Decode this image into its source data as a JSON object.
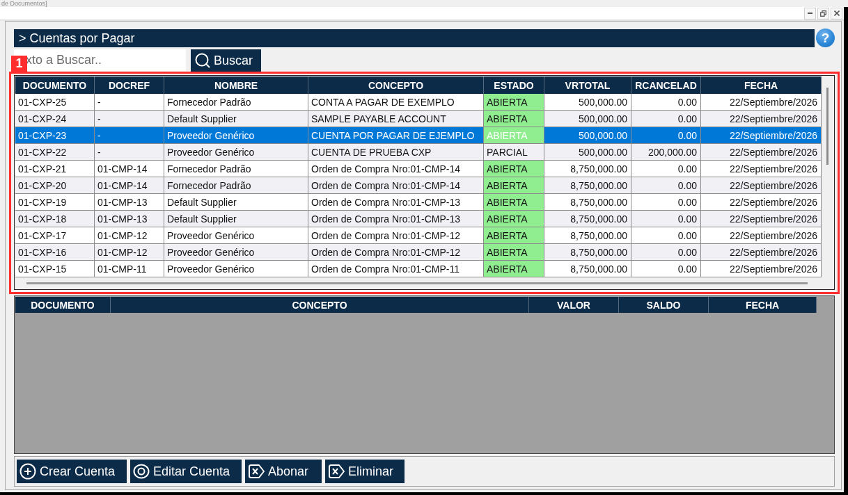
{
  "window": {
    "title": "de Documentos]"
  },
  "section": {
    "title": "> Cuentas por Pagar",
    "help": "?"
  },
  "search": {
    "placeholder": "xto a Buscar..",
    "button": "Buscar"
  },
  "annotation": {
    "label": "1"
  },
  "table": {
    "columns": [
      "DOCUMENTO",
      "DOCREF",
      "NOMBRE",
      "CONCEPTO",
      "ESTADO",
      "VRTOTAL",
      "RCANCELAD",
      "FECHA"
    ],
    "rows": [
      {
        "selected": false,
        "documento": "01-CXP-25",
        "docref": "-",
        "nombre": "Fornecedor Padrão",
        "concepto": "CONTA A PAGAR DE EXEMPLO",
        "estado": {
          "label": "ABIERTA",
          "color": "#90ee90"
        },
        "vrtotal": "500,000.00",
        "column_7": "0.00",
        "fecha": "22/Septiembre/2026"
      },
      {
        "selected": false,
        "documento": "01-CXP-24",
        "docref": "-",
        "nombre": "Default Supplier",
        "concepto": "SAMPLE PAYABLE ACCOUNT",
        "estado": {
          "label": "ABIERTA",
          "color": "#90ee90"
        },
        "vrtotal": "500,000.00",
        "column_7": "0.00",
        "fecha": "22/Septiembre/2026"
      },
      {
        "selected": true,
        "documento": "01-CXP-23",
        "docref": "-",
        "nombre": "Proveedor Genérico",
        "concepto": "CUENTA POR PAGAR DE EJEMPLO",
        "estado": {
          "label": "ABIERTA",
          "color": "#90ee90"
        },
        "vrtotal": "500,000.00",
        "column_7": "0.00",
        "fecha": "22/Septiembre/2026"
      },
      {
        "selected": false,
        "documento": "01-CXP-22",
        "docref": "-",
        "nombre": "Proveedor Genérico",
        "concepto": "CUENTA DE PRUEBA CXP",
        "estado": {
          "label": "PARCIAL"
        },
        "vrtotal": "500,000.00",
        "column_7": "200,000.00",
        "fecha": "22/Septiembre/2026"
      },
      {
        "selected": false,
        "documento": "01-CXP-21",
        "docref": "01-CMP-14",
        "nombre": "Fornecedor Padrão",
        "concepto": "Orden de Compra Nro:01-CMP-14",
        "estado": {
          "label": "ABIERTA",
          "color": "#90ee90"
        },
        "vrtotal": "8,750,000.00",
        "column_7": "0.00",
        "fecha": "22/Septiembre/2026"
      },
      {
        "selected": false,
        "documento": "01-CXP-20",
        "docref": "01-CMP-14",
        "nombre": "Fornecedor Padrão",
        "concepto": "Orden de Compra Nro:01-CMP-14",
        "estado": {
          "label": "ABIERTA",
          "color": "#90ee90"
        },
        "vrtotal": "8,750,000.00",
        "column_7": "0.00",
        "fecha": "22/Septiembre/2026"
      },
      {
        "selected": false,
        "documento": "01-CXP-19",
        "docref": "01-CMP-13",
        "nombre": "Default Supplier",
        "concepto": "Orden de Compra Nro:01-CMP-13",
        "estado": {
          "label": "ABIERTA",
          "color": "#90ee90"
        },
        "vrtotal": "8,750,000.00",
        "column_7": "0.00",
        "fecha": "22/Septiembre/2026"
      },
      {
        "selected": false,
        "documento": "01-CXP-18",
        "docref": "01-CMP-13",
        "nombre": "Default Supplier",
        "concepto": "Orden de Compra Nro:01-CMP-13",
        "estado": {
          "label": "ABIERTA",
          "color": "#90ee90"
        },
        "vrtotal": "8,750,000.00",
        "column_7": "0.00",
        "fecha": "22/Septiembre/2026"
      },
      {
        "selected": false,
        "documento": "01-CXP-17",
        "docref": "01-CMP-12",
        "nombre": "Proveedor Genérico",
        "concepto": "Orden de Compra Nro:01-CMP-12",
        "estado": {
          "label": "ABIERTA",
          "color": "#90ee90"
        },
        "vrtotal": "8,750,000.00",
        "column_7": "0.00",
        "fecha": "22/Septiembre/2026"
      },
      {
        "selected": false,
        "documento": "01-CXP-16",
        "docref": "01-CMP-12",
        "nombre": "Proveedor Genérico",
        "concepto": "Orden de Compra Nro:01-CMP-12",
        "estado": {
          "label": "ABIERTA",
          "color": "#90ee90"
        },
        "vrtotal": "8,750,000.00",
        "column_7": "0.00",
        "fecha": "22/Septiembre/2026"
      },
      {
        "selected": false,
        "documento": "01-CXP-15",
        "docref": "01-CMP-11",
        "nombre": "Proveedor Genérico",
        "concepto": "Orden de Compra Nro:01-CMP-11",
        "estado": {
          "label": "ABIERTA",
          "color": "#90ee90"
        },
        "vrtotal": "8,750,000.00",
        "column_7": "0.00",
        "fecha": "22/Septiembre/2026"
      }
    ]
  },
  "detail": {
    "columns": [
      "DOCUMENTO",
      "CONCEPTO",
      "VALOR",
      "SALDO",
      "FECHA"
    ]
  },
  "actions": [
    {
      "label": "Crear Cuenta"
    },
    {
      "label": "Editar Cuenta"
    },
    {
      "label": "Abonar"
    },
    {
      "label": "Eliminar"
    }
  ]
}
